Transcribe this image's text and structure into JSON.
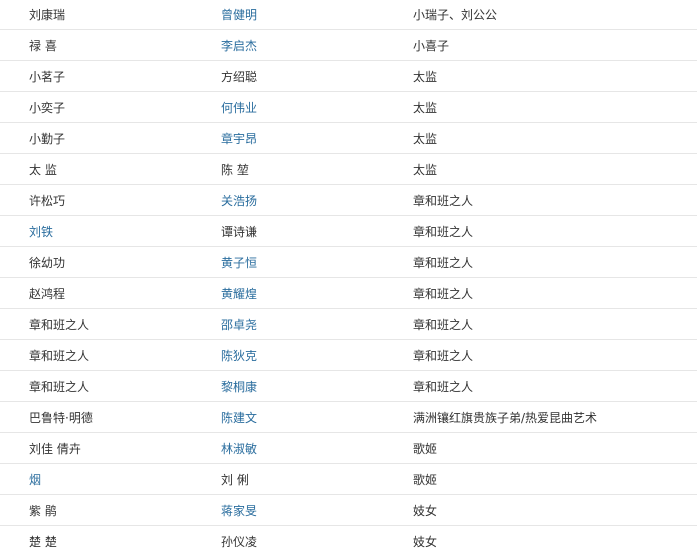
{
  "rows": [
    {
      "role": "刘康瑞",
      "actor": "曾健明",
      "desc": "小瑞子、刘公公",
      "role_link": false,
      "actor_link": true
    },
    {
      "role": "禄  喜",
      "actor": "李启杰",
      "desc": "小喜子",
      "role_link": false,
      "actor_link": true
    },
    {
      "role": "小茗子",
      "actor": "方绍聪",
      "desc": "太监",
      "role_link": false,
      "actor_link": false
    },
    {
      "role": "小奕子",
      "actor": "何伟业",
      "desc": "太监",
      "role_link": false,
      "actor_link": true
    },
    {
      "role": "小勤子",
      "actor": "章宇昂",
      "desc": "太监",
      "role_link": false,
      "actor_link": true
    },
    {
      "role": "太  监",
      "actor": "陈  堃",
      "desc": "太监",
      "role_link": false,
      "actor_link": false
    },
    {
      "role": "许松巧",
      "actor": "关浩扬",
      "desc": "章和班之人",
      "role_link": false,
      "actor_link": true
    },
    {
      "role": "刘铁",
      "actor": "谭诗谦",
      "desc": "章和班之人",
      "role_link": true,
      "actor_link": false
    },
    {
      "role": "徐幼功",
      "actor": "黄子恒",
      "desc": "章和班之人",
      "role_link": false,
      "actor_link": true
    },
    {
      "role": "赵鸿程",
      "actor": "黄耀煌",
      "desc": "章和班之人",
      "role_link": false,
      "actor_link": true
    },
    {
      "role": "章和班之人",
      "actor": "邵卓尧",
      "desc": "章和班之人",
      "role_link": false,
      "actor_link": true
    },
    {
      "role": "章和班之人",
      "actor": "陈狄克",
      "desc": "章和班之人",
      "role_link": false,
      "actor_link": true
    },
    {
      "role": "章和班之人",
      "actor": "黎桐康",
      "desc": "章和班之人",
      "role_link": false,
      "actor_link": true
    },
    {
      "role": "巴鲁特·明德",
      "actor": "陈建文",
      "desc": "满洲镶红旗贵族子弟/热爱昆曲艺术",
      "role_link": false,
      "actor_link": true
    },
    {
      "role": "刘佳 倩卉",
      "actor": "林淑敏",
      "desc": "歌姬",
      "role_link": false,
      "actor_link": true
    },
    {
      "role": "烟",
      "actor": "刘  俐",
      "desc": "歌姬",
      "role_link": true,
      "actor_link": false
    },
    {
      "role": "紫  鹃",
      "actor": "蒋家旻",
      "desc": "妓女",
      "role_link": false,
      "actor_link": true
    },
    {
      "role": "楚  楚",
      "actor": "孙仪凌",
      "desc": "妓女",
      "role_link": false,
      "actor_link": false
    }
  ]
}
